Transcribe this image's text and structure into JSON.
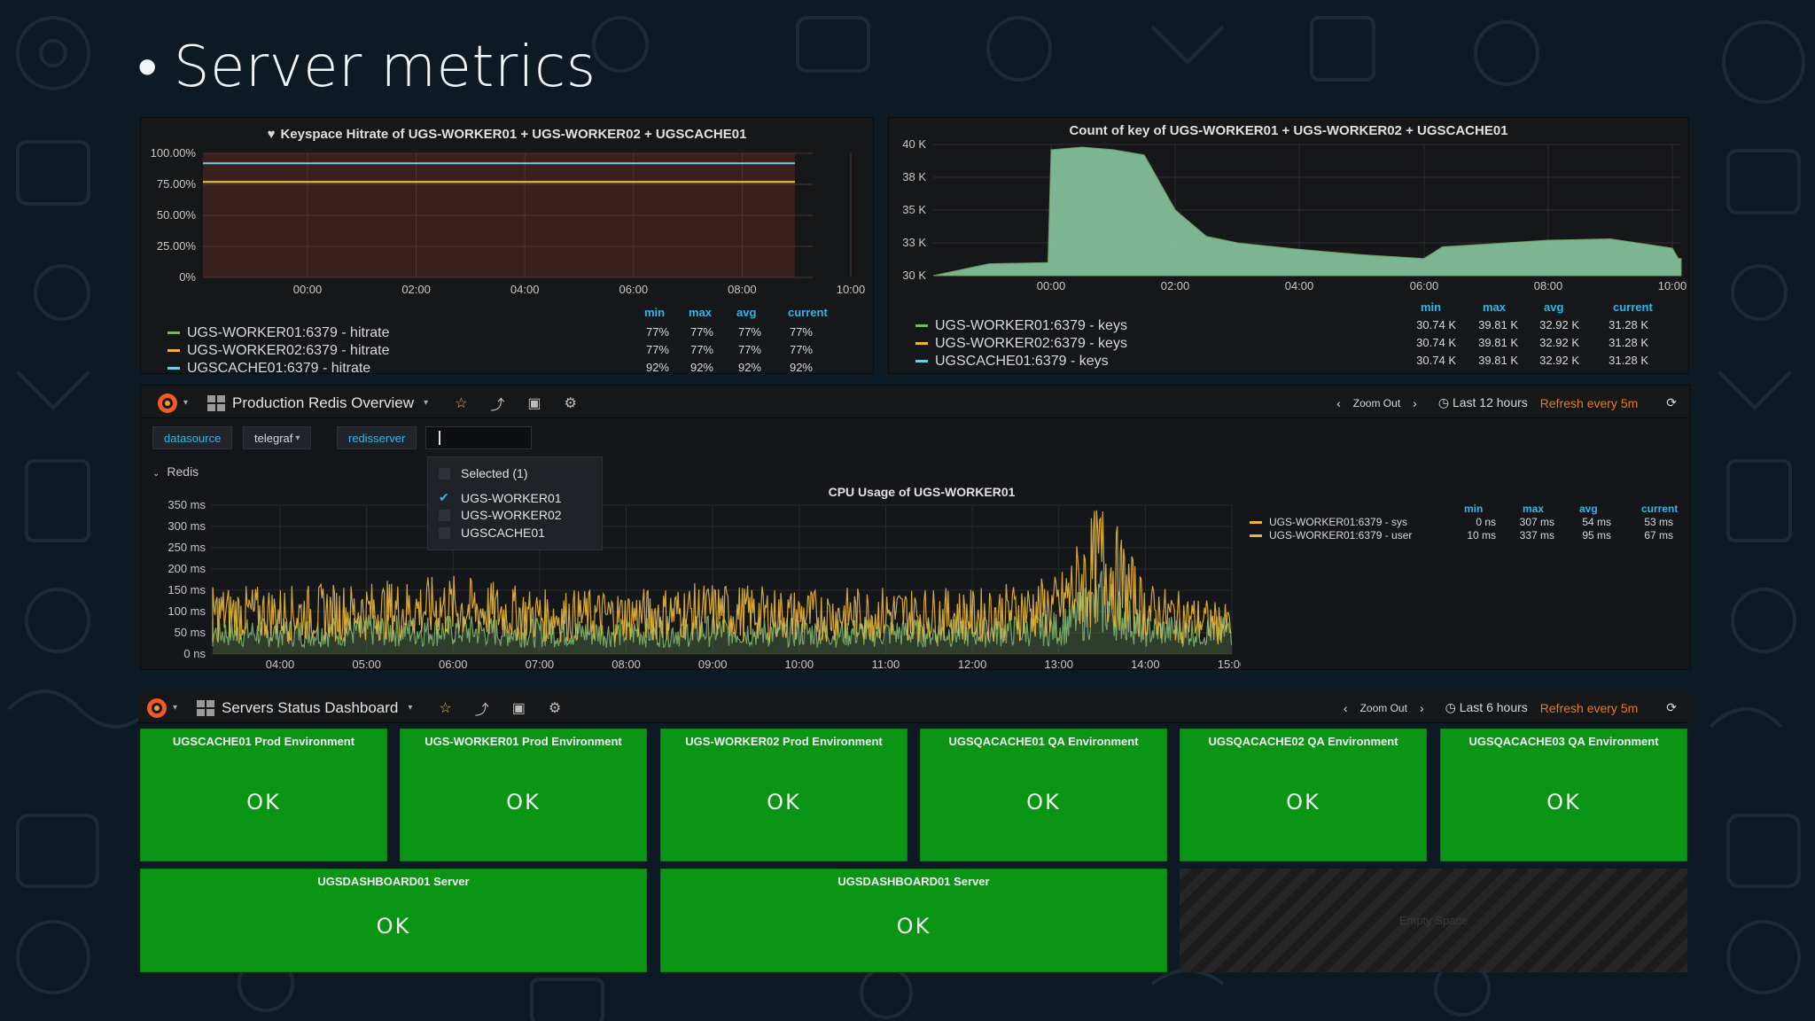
{
  "slide": {
    "bullet": "•",
    "title": "Server metrics"
  },
  "colors": {
    "green": "#7eb26d",
    "yellow": "#eab839",
    "blue": "#6ed0e0",
    "accent": "#33b5e5",
    "refresh": "#eb7b18",
    "ok_tile": "#0a9515"
  },
  "hitrate_panel": {
    "title": "Keyspace Hitrate of UGS-WORKER01 + UGS-WORKER02 + UGSCACHE01",
    "heart_icon": "heart-icon",
    "y_ticks": [
      "100.00%",
      "75.00%",
      "50.00%",
      "25.00%",
      "0%"
    ],
    "x_ticks": [
      "00:00",
      "02:00",
      "04:00",
      "06:00",
      "08:00",
      "10:00"
    ],
    "legend_headers": [
      "min",
      "max",
      "avg",
      "current"
    ],
    "legend": [
      {
        "name": "UGS-WORKER01:6379 - hitrate",
        "color": "#7eb26d",
        "min": "77%",
        "max": "77%",
        "avg": "77%",
        "current": "77%"
      },
      {
        "name": "UGS-WORKER02:6379 - hitrate",
        "color": "#eab839",
        "min": "77%",
        "max": "77%",
        "avg": "77%",
        "current": "77%"
      },
      {
        "name": "UGSCACHE01:6379 - hitrate",
        "color": "#6ed0e0",
        "min": "92%",
        "max": "92%",
        "avg": "92%",
        "current": "92%"
      }
    ]
  },
  "keys_panel": {
    "title": "Count of key of UGS-WORKER01 + UGS-WORKER02 + UGSCACHE01",
    "y_ticks": [
      "40 K",
      "38 K",
      "35 K",
      "33 K",
      "30 K"
    ],
    "x_ticks": [
      "00:00",
      "02:00",
      "04:00",
      "06:00",
      "08:00",
      "10:00"
    ],
    "legend_headers": [
      "min",
      "max",
      "avg",
      "current"
    ],
    "legend": [
      {
        "name": "UGS-WORKER01:6379 - keys",
        "color": "#7eb26d",
        "min": "30.74 K",
        "max": "39.81 K",
        "avg": "32.92 K",
        "current": "31.28 K"
      },
      {
        "name": "UGS-WORKER02:6379 - keys",
        "color": "#eab839",
        "min": "30.74 K",
        "max": "39.81 K",
        "avg": "32.92 K",
        "current": "31.28 K"
      },
      {
        "name": "UGSCACHE01:6379 - keys",
        "color": "#6ed0e0",
        "min": "30.74 K",
        "max": "39.81 K",
        "avg": "32.92 K",
        "current": "31.28 K"
      }
    ]
  },
  "redis_dash": {
    "title": "Production Redis Overview",
    "zoom_out": "Zoom Out",
    "time_range": "Last 12 hours",
    "refresh": "Refresh every 5m",
    "vars": {
      "datasource": "datasource",
      "telegraf": "telegraf",
      "redisserver": "redisserver"
    },
    "dropdown": {
      "header": "Selected (1)",
      "options": [
        {
          "label": "UGS-WORKER01",
          "checked": true
        },
        {
          "label": "UGS-WORKER02",
          "checked": false
        },
        {
          "label": "UGSCACHE01",
          "checked": false
        }
      ]
    },
    "row_title": "Redis",
    "cpu_panel": {
      "title": "CPU Usage of UGS-WORKER01",
      "y_ticks": [
        "350 ms",
        "300 ms",
        "250 ms",
        "200 ms",
        "150 ms",
        "100 ms",
        "50 ms",
        "0 ns"
      ],
      "x_ticks": [
        "04:00",
        "05:00",
        "06:00",
        "07:00",
        "08:00",
        "09:00",
        "10:00",
        "11:00",
        "12:00",
        "13:00",
        "14:00",
        "15:00"
      ],
      "legend_headers": [
        "min",
        "max",
        "avg",
        "current"
      ],
      "legend": [
        {
          "name": "UGS-WORKER01:6379 - sys",
          "color": "#eab839",
          "min": "0 ns",
          "max": "307 ms",
          "avg": "54 ms",
          "current": "53 ms"
        },
        {
          "name": "UGS-WORKER01:6379 - user",
          "color": "#eab839",
          "min": "10 ms",
          "max": "337 ms",
          "avg": "95 ms",
          "current": "67 ms"
        }
      ]
    }
  },
  "status_dash": {
    "title": "Servers Status Dashboard",
    "zoom_out": "Zoom Out",
    "time_range": "Last 6 hours",
    "refresh": "Refresh every 5m",
    "tiles": [
      {
        "title": "UGSCACHE01 Prod Environment",
        "status": "OK"
      },
      {
        "title": "UGS-WORKER01 Prod Environment",
        "status": "OK"
      },
      {
        "title": "UGS-WORKER02 Prod Environment",
        "status": "OK"
      },
      {
        "title": "UGSQACACHE01 QA Environment",
        "status": "OK"
      },
      {
        "title": "UGSQACACHE02 QA Environment",
        "status": "OK"
      },
      {
        "title": "UGSQACACHE03 QA Environment",
        "status": "OK"
      },
      {
        "title": "UGSDASHBOARD01 Server",
        "status": "OK"
      },
      {
        "title": "UGSDASHBOARD01 Server",
        "status": "OK"
      }
    ],
    "empty_space": "Empty Space"
  },
  "chart_data": [
    {
      "type": "line",
      "title": "Keyspace Hitrate of UGS-WORKER01 + UGS-WORKER02 + UGSCACHE01",
      "x": [
        "00:00",
        "02:00",
        "04:00",
        "06:00",
        "08:00",
        "10:00"
      ],
      "ylim": [
        0,
        100
      ],
      "series": [
        {
          "name": "UGS-WORKER01:6379 - hitrate",
          "values": [
            77,
            77,
            77,
            77,
            77,
            77
          ]
        },
        {
          "name": "UGS-WORKER02:6379 - hitrate",
          "values": [
            77,
            77,
            77,
            77,
            77,
            77
          ]
        },
        {
          "name": "UGSCACHE01:6379 - hitrate",
          "values": [
            92,
            92,
            92,
            92,
            92,
            92
          ]
        }
      ]
    },
    {
      "type": "area",
      "title": "Count of key of UGS-WORKER01 + UGS-WORKER02 + UGSCACHE01",
      "x": [
        "-01:00",
        "-00:30",
        "00:00",
        "00:30",
        "01:00",
        "01:30",
        "02:00",
        "02:30",
        "03:00",
        "04:00",
        "05:00",
        "06:00",
        "06:30",
        "07:00",
        "08:00",
        "09:00",
        "10:00",
        "10:10"
      ],
      "ylim": [
        30,
        40
      ],
      "series": [
        {
          "name": "UGS-WORKER01:6379 - keys",
          "values": [
            30.9,
            31.0,
            39.6,
            39.8,
            39.6,
            39.2,
            35.0,
            33.0,
            32.5,
            32.0,
            31.6,
            31.3,
            32.2,
            32.4,
            32.7,
            32.8,
            32.1,
            31.3
          ]
        }
      ]
    },
    {
      "type": "line",
      "title": "CPU Usage of UGS-WORKER01",
      "x": [
        "04:00",
        "05:00",
        "06:00",
        "07:00",
        "08:00",
        "09:00",
        "10:00",
        "11:00",
        "12:00",
        "13:00",
        "13:30",
        "14:00",
        "15:00"
      ],
      "ylim": [
        0,
        350
      ],
      "series": [
        {
          "name": "UGS-WORKER01:6379 - sys",
          "values": [
            50,
            55,
            55,
            50,
            50,
            55,
            50,
            50,
            50,
            60,
            120,
            55,
            53
          ]
        },
        {
          "name": "UGS-WORKER01:6379 - user",
          "values": [
            95,
            100,
            110,
            90,
            90,
            100,
            90,
            95,
            90,
            110,
            220,
            100,
            67
          ]
        }
      ]
    }
  ]
}
